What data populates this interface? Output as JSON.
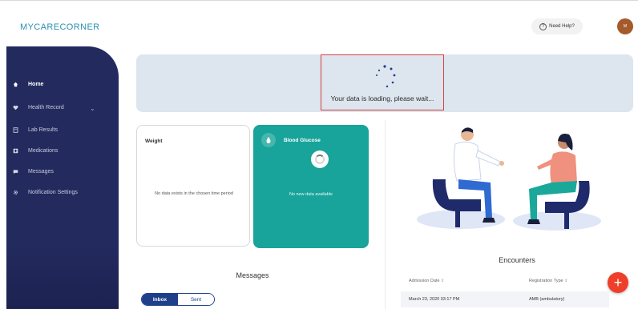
{
  "header": {
    "logo_text": "MYCARECORNER",
    "help_label": "Need Help?",
    "avatar_initials": "M"
  },
  "sidebar": {
    "items": [
      {
        "label": "Home",
        "icon": "home-icon",
        "active": true
      },
      {
        "label": "Health Record",
        "icon": "heart-icon",
        "active": false
      },
      {
        "label": "Lab Results",
        "icon": "lab-icon",
        "active": false
      },
      {
        "label": "Medications",
        "icon": "medication-icon",
        "active": false
      },
      {
        "label": "Messages",
        "icon": "message-icon",
        "active": false
      },
      {
        "label": "Notification Settings",
        "icon": "gear-icon",
        "active": false
      }
    ]
  },
  "loading": {
    "text": "Your data is loading, please wait..."
  },
  "weight_card": {
    "title": "Weight",
    "empty_text": "No data exists in the chosen time period"
  },
  "glucose_card": {
    "title": "Blood Glucose",
    "empty_text": "No new data available"
  },
  "messages": {
    "title": "Messages",
    "tabs": [
      "Inbox",
      "Sent"
    ]
  },
  "encounters": {
    "title": "Encounters",
    "columns": [
      "Admission Date",
      "Registration Type"
    ],
    "rows": [
      {
        "date": "March 23, 2020 03:17 PM",
        "type": "AMB (ambulatory)"
      }
    ]
  },
  "colors": {
    "sidebar": "#232a5e",
    "teal": "#18a49a",
    "accent_red": "#ef3f2a",
    "banner": "#dde5ef",
    "highlight_box": "#d9413b"
  }
}
